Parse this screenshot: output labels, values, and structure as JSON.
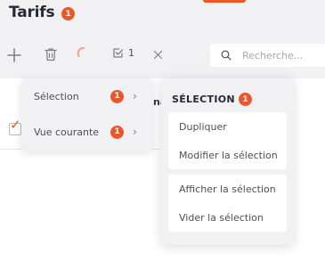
{
  "page": {
    "title": "Tarifs",
    "title_badge": "1"
  },
  "toolbar": {
    "selection_count": "1",
    "search_placeholder": "Recherche..."
  },
  "table": {
    "partial_header": "na"
  },
  "context_menu": {
    "items": [
      {
        "label": "Sélection",
        "badge": "1",
        "chevron": "›"
      },
      {
        "label": "Vue courante",
        "badge": "1",
        "chevron": "›"
      }
    ]
  },
  "submenu": {
    "title": "SÉLECTION",
    "badge": "1",
    "group1": [
      "Dupliquer",
      "Modifier la sélection"
    ],
    "group2": [
      "Afficher la sélection",
      "Vider la sélection"
    ]
  },
  "colors": {
    "accent": "#e9572b",
    "panel_bg": "#f1f1f3",
    "text": "#4a505a"
  },
  "icons": [
    "plus-icon",
    "trash-icon",
    "spinner-icon",
    "checkbox-icon",
    "close-icon",
    "search-icon",
    "chevron-right-icon"
  ]
}
